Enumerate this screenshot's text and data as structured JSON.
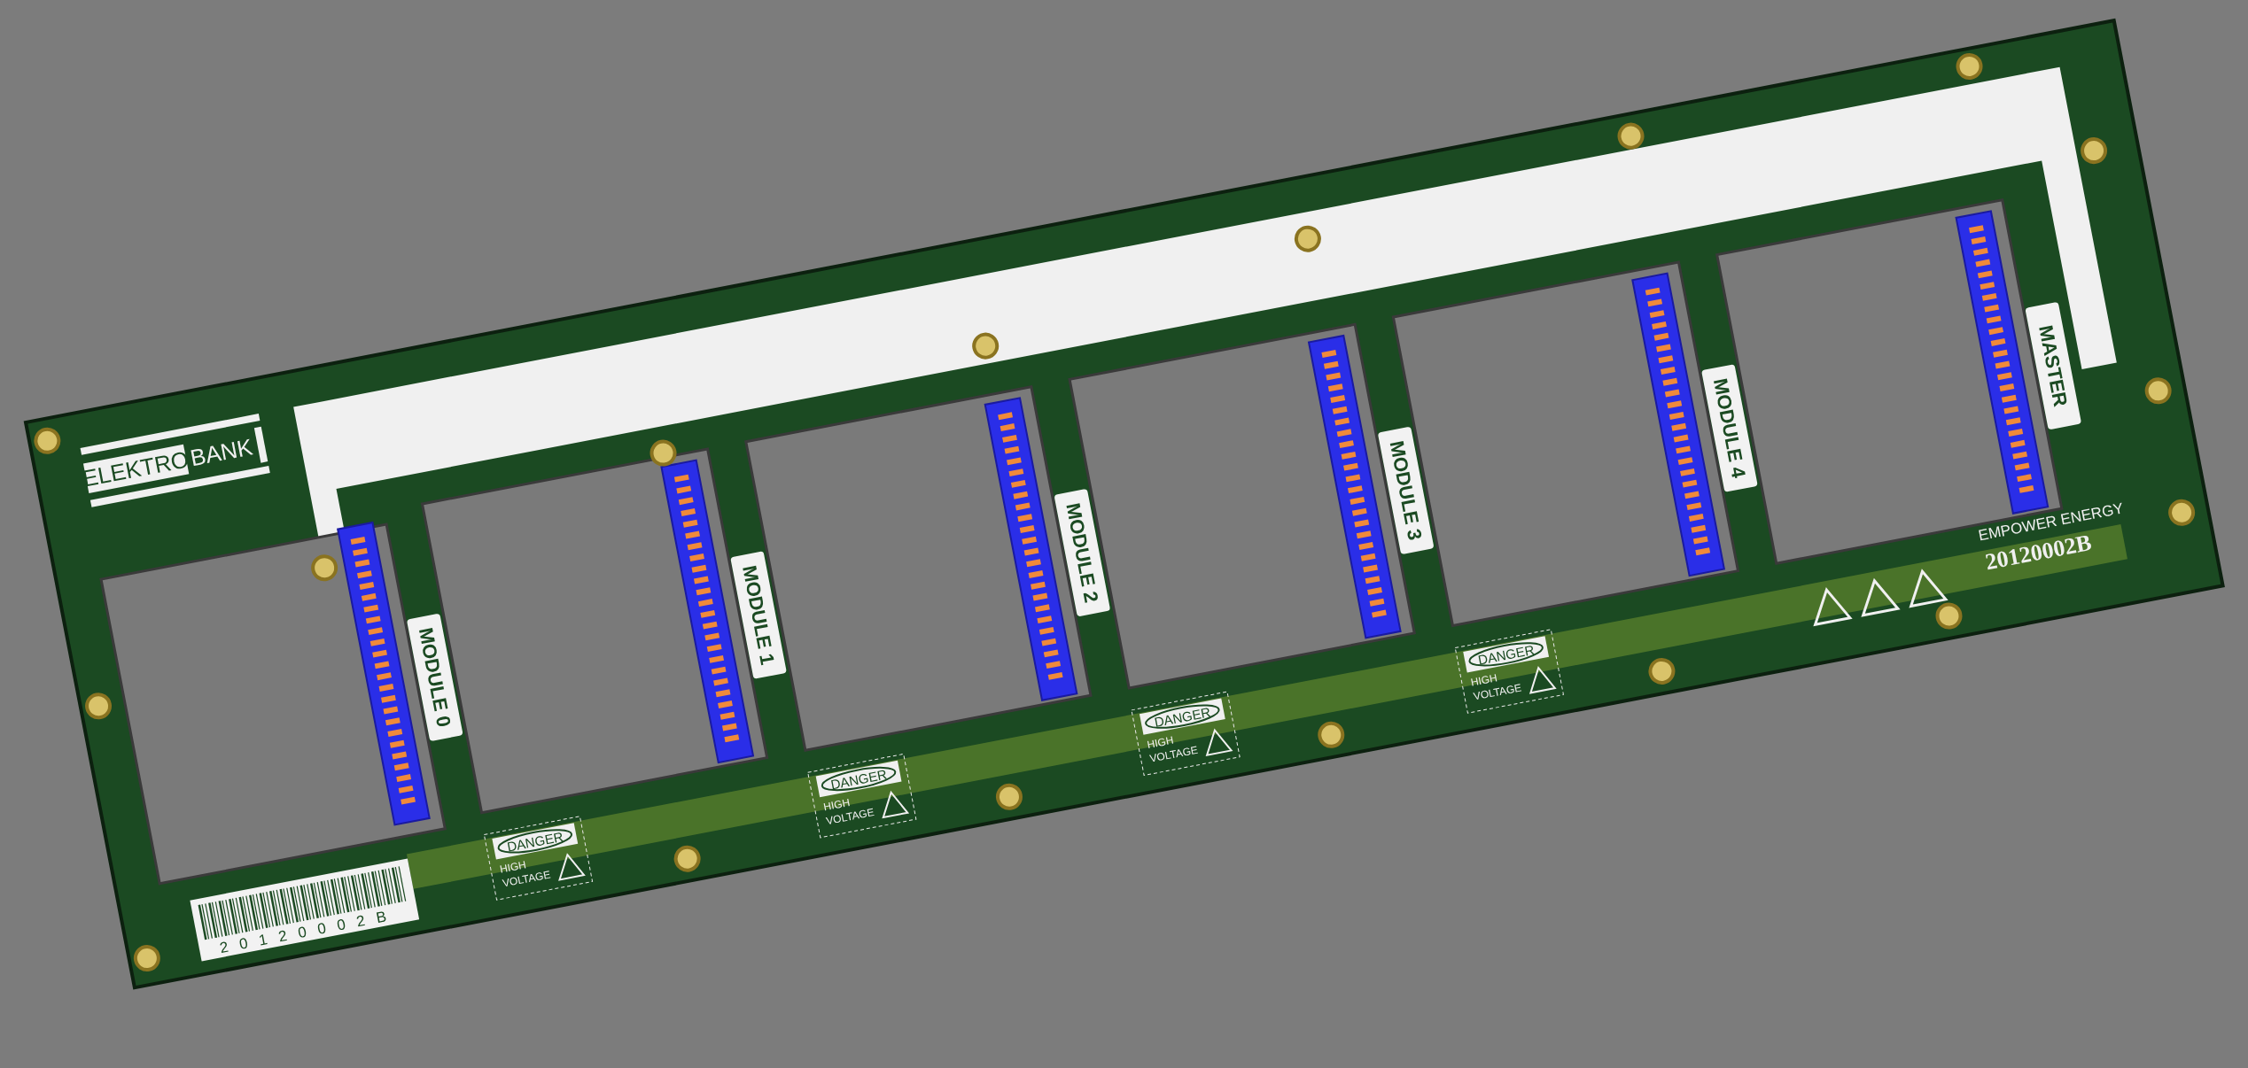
{
  "board": {
    "logo": {
      "left": "ELEKTRO",
      "right": "BANK"
    },
    "slots": [
      {
        "label": "MODULE 0"
      },
      {
        "label": "MODULE 1"
      },
      {
        "label": "MODULE 2"
      },
      {
        "label": "MODULE 3"
      },
      {
        "label": "MODULE 4"
      },
      {
        "label": "MASTER"
      }
    ],
    "warnings": [
      {
        "title": "DANGER",
        "lines": [
          "HIGH",
          "VOLTAGE"
        ]
      },
      {
        "title": "DANGER",
        "lines": [
          "HIGH",
          "VOLTAGE"
        ]
      },
      {
        "title": "DANGER",
        "lines": [
          "HIGH",
          "VOLTAGE"
        ]
      },
      {
        "title": "DANGER",
        "lines": [
          "HIGH",
          "VOLTAGE"
        ]
      }
    ],
    "barcode": "20120002B",
    "maker": "EMPOWER ENERGY",
    "part_number": "20120002B"
  }
}
